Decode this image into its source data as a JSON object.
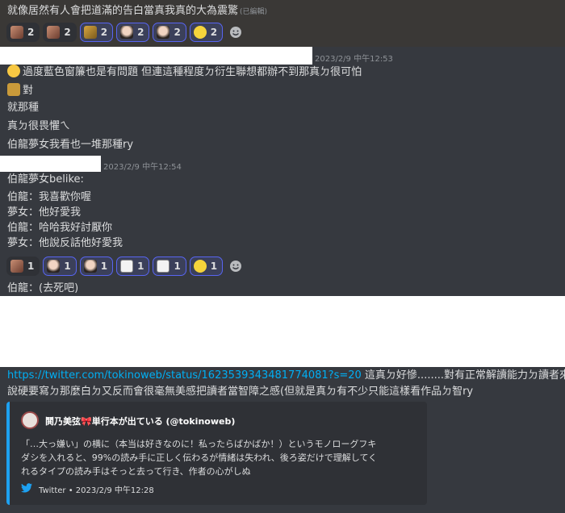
{
  "top_message": {
    "text": "就像居然有人會把道滿的告白當真我真的大為震驚",
    "edited_label": "(已編輯)",
    "reactions": [
      {
        "emoji": "face-avatar-emoji",
        "count": "2",
        "me": false
      },
      {
        "emoji": "face-avatar-emoji",
        "count": "2",
        "me": false
      },
      {
        "emoji": "doge-emoji",
        "count": "2",
        "me": true
      },
      {
        "emoji": "portrait-emoji",
        "count": "2",
        "me": true
      },
      {
        "emoji": "portrait-emoji",
        "count": "2",
        "me": true
      },
      {
        "emoji": "pikachu-emoji",
        "count": "2",
        "me": true
      }
    ]
  },
  "group1": {
    "timestamp": "2023/2/9 中午12:53",
    "lines": [
      "過度藍色窗簾也是有問題 但連這種程度ㄉ衍生聯想都辦不到那真ㄉ很可怕",
      "對",
      "就那種",
      "真ㄉ很畏懼ㄟ",
      "伯龍夢女我看也一堆那種ry"
    ]
  },
  "group2": {
    "timestamp": "2023/2/9 中午12:54",
    "lines": [
      "伯龍夢女belike:",
      "伯龍：我喜歡你喔",
      "夢女：他好愛我",
      "伯龍：哈哈我好討厭你",
      "夢女：他說反話他好愛我"
    ],
    "reactions": [
      {
        "emoji": "face-avatar-emoji",
        "count": "1",
        "me": false
      },
      {
        "emoji": "portrait-emoji",
        "count": "1",
        "me": true
      },
      {
        "emoji": "portrait-emoji",
        "count": "1",
        "me": true
      },
      {
        "emoji": "sketch-emoji",
        "count": "1",
        "me": true
      },
      {
        "emoji": "sketch-emoji",
        "count": "1",
        "me": true
      },
      {
        "emoji": "pikachu-emoji",
        "count": "1",
        "me": true
      }
    ],
    "after_line": "伯龍：(去死吧)"
  },
  "group3": {
    "link": "https://twitter.com/tokinoweb/status/1623539343481774081?s=20",
    "line1_rest": " 這真ㄉ好慘........對有正常解讀能力ㄉ讀者來",
    "line2": "說硬要寫ㄉ那麼白ㄉ又反而會很毫無美感把讀者當智障之感(但就是真ㄉ有不少只能這樣看作品ㄉ智ry",
    "embed": {
      "author": "鬨乃美弦🎀単行本が出ている (@tokinoweb)",
      "desc_lines": [
        "「…大っ嫌い」の横に（本当は好きなのに！私ったらばかばか！）というモノローグフキ",
        "ダシを入れると、99%の読み手に正しく伝わるが情緒は失われ、後ろ姿だけで理解してく",
        "れるタイプの読み手はそっと去って行き、作者の心がしぬ"
      ],
      "footer": "Twitter • 2023/2/9 中午12:28"
    }
  },
  "colors": {
    "background": "#36393f",
    "reaction_me_border": "#5865f2",
    "link": "#00aff4",
    "twitter_blue": "#1da1f2"
  }
}
